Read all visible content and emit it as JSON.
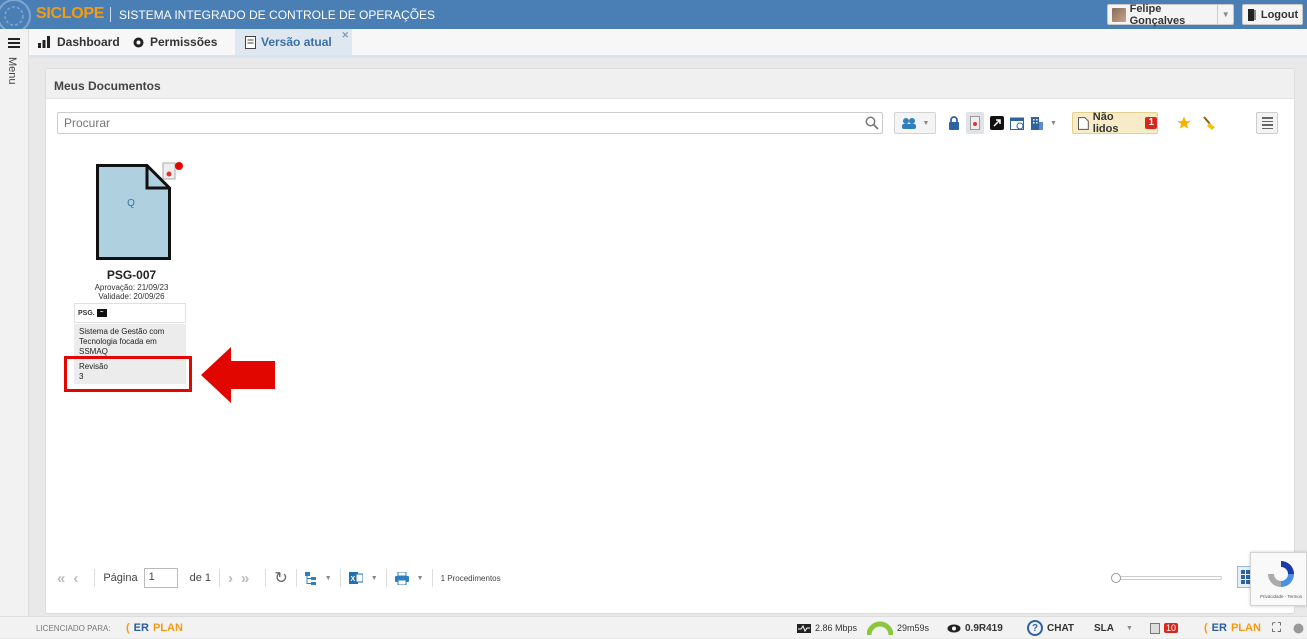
{
  "header": {
    "brand": "SICLOPE",
    "subtitle": "SISTEMA INTEGRADO DE CONTROLE DE OPERAÇÕES",
    "user_name": "Felipe Gonçalves",
    "logout_label": "Logout"
  },
  "sidebar": {
    "menu_label": "Menu"
  },
  "tabs": [
    {
      "label": "Dashboard",
      "icon": "bar-chart-icon"
    },
    {
      "label": "Permissões",
      "icon": "gear-icon"
    },
    {
      "label": "Versão atual",
      "icon": "document-icon",
      "active": true
    }
  ],
  "panel": {
    "title": "Meus Documentos"
  },
  "search": {
    "placeholder": "Procurar"
  },
  "toolbar": {
    "unread_label": "Não lidos",
    "unread_count": "1"
  },
  "document": {
    "thumb_letter": "Q",
    "code": "PSG-007",
    "approval": "Aprovação: 21/09/23",
    "validity": "Validade: 20/09/26",
    "tag": "PSG.",
    "description": "Sistema de Gestão com Tecnologia focada em SSMAQ",
    "revision_label": "Revisão",
    "revision_value": "3"
  },
  "pager": {
    "page_label": "Página",
    "page_value": "1",
    "of_label": "de 1",
    "count_label": "1 Procedimentos"
  },
  "recaptcha": {
    "text": "Privacidade - Termos"
  },
  "statusbar": {
    "licensed_label": "LICENCIADO PARA:",
    "erplan_er": "ER",
    "erplan_plan": "PLAN",
    "speed": "2.86 Mbps",
    "timer": "29m59s",
    "version": "0.9R419",
    "chat": "CHAT",
    "sla": "SLA",
    "notif_count": "10"
  },
  "colors": {
    "topbar": "#4a7fb5",
    "brand": "#f39c12",
    "highlight": "#e10600",
    "doc_fill": "#aed0df"
  }
}
